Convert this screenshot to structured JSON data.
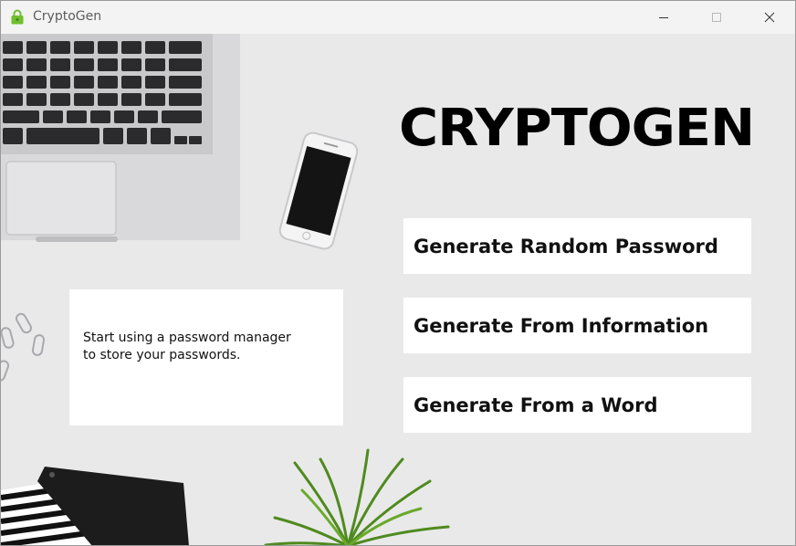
{
  "window": {
    "title": "CryptoGen",
    "app_icon": "green-lock-icon",
    "controls": [
      "minimize-icon",
      "maximize-icon",
      "close-icon"
    ]
  },
  "main": {
    "heading": "CRYPTOGEN",
    "buttons": [
      {
        "label": "Generate Random Password"
      },
      {
        "label": "Generate From Information"
      },
      {
        "label": "Generate From a Word"
      }
    ],
    "tip": "Start using a password manager\nto store your passwords."
  },
  "colors": {
    "background": "#e9e9ea",
    "button_bg": "#ffffff",
    "heading": "#000000",
    "app_icon": "#6fbf2e"
  }
}
